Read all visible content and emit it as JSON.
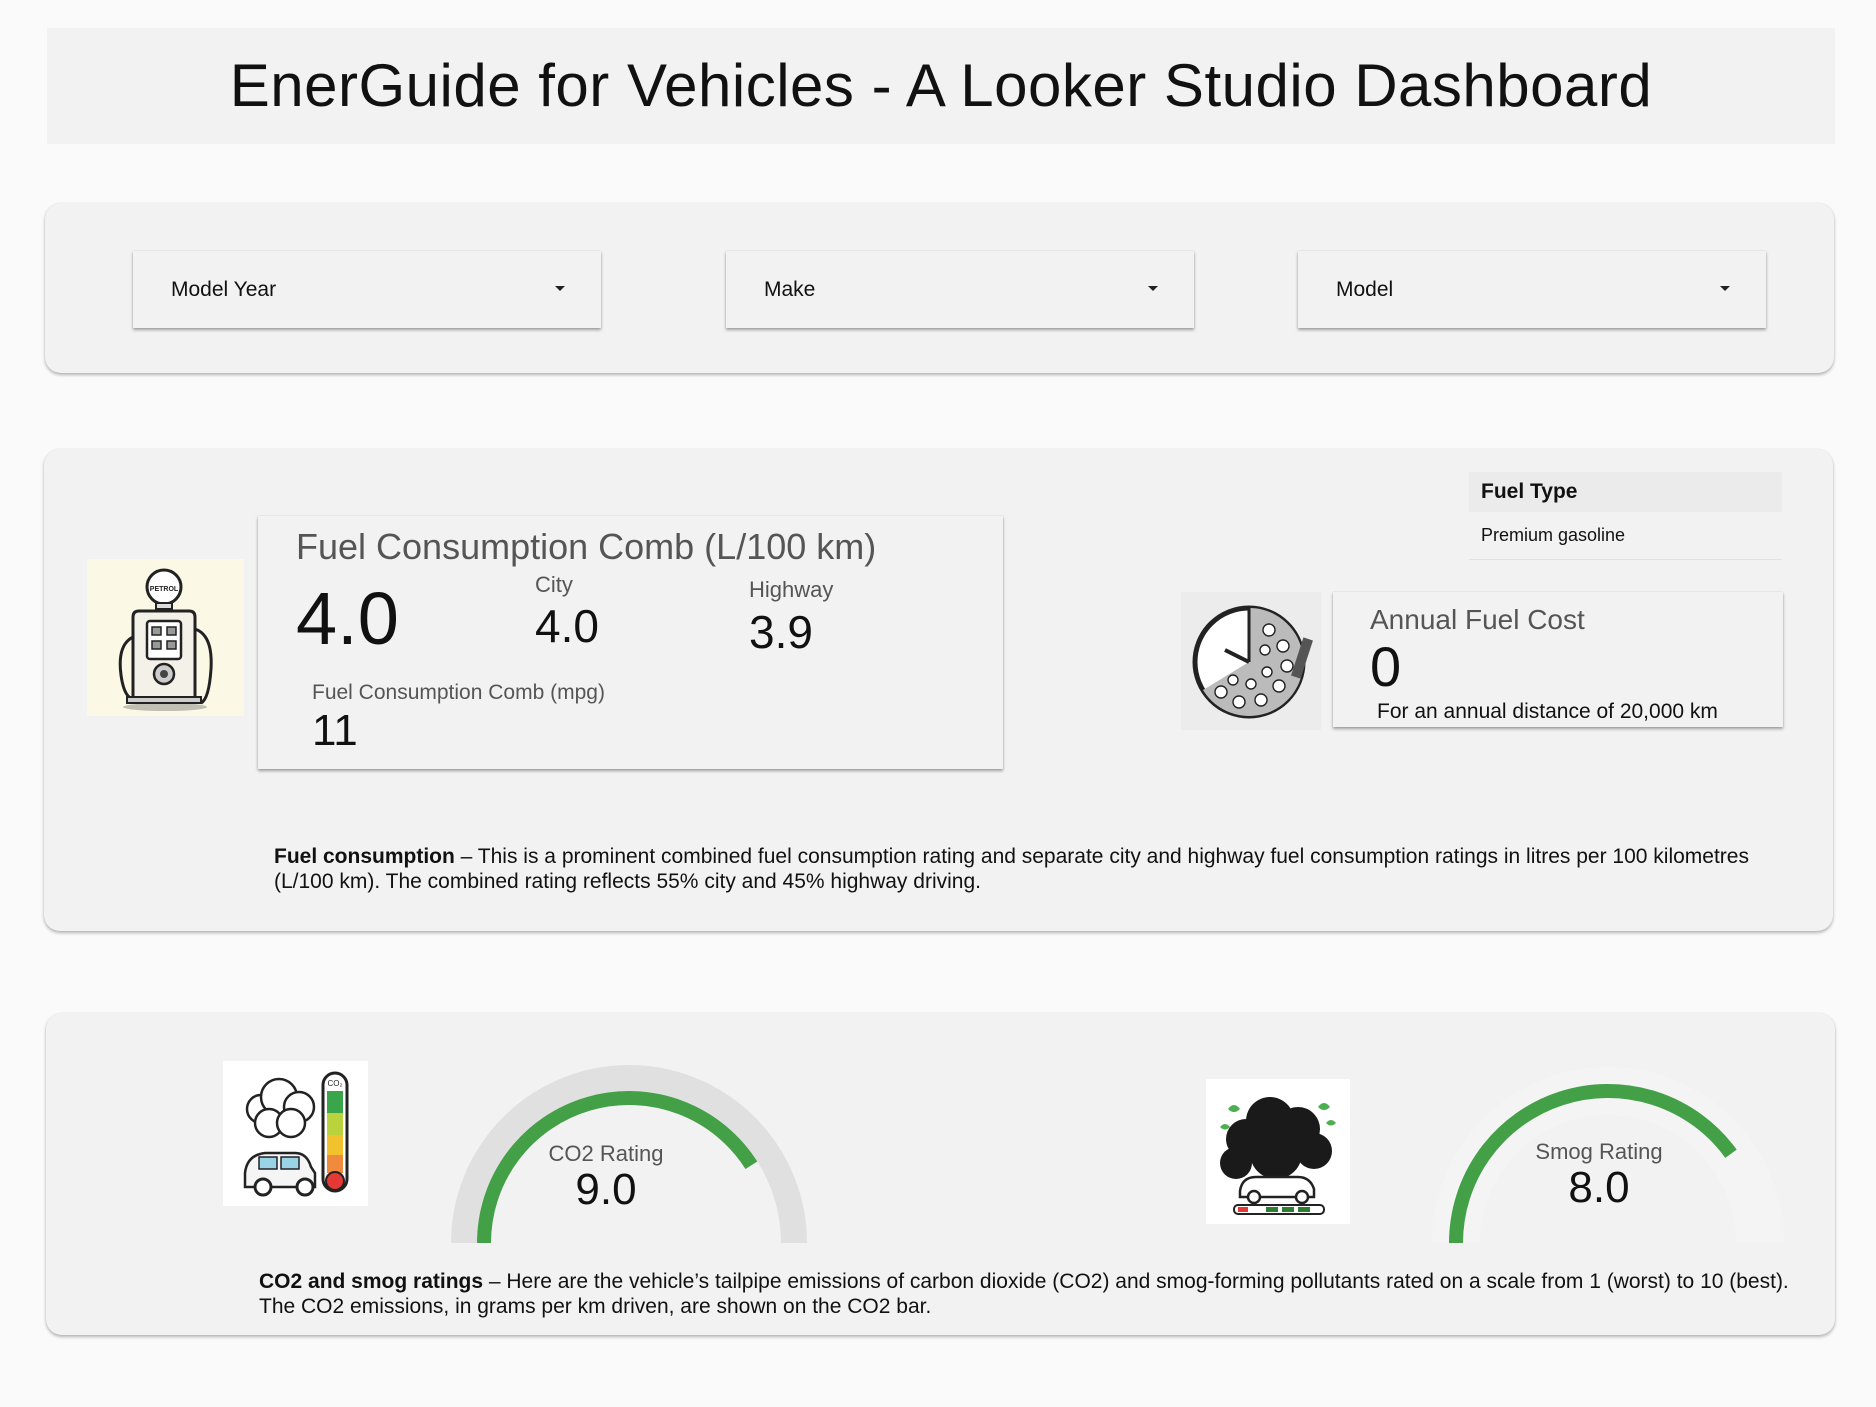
{
  "header": {
    "title": "EnerGuide for Vehicles - A Looker Studio Dashboard"
  },
  "filters": {
    "model_year": "Model Year",
    "make": "Make",
    "model": "Model"
  },
  "fuel_section": {
    "comb_title": "Fuel Consumption Comb (L/100 km)",
    "comb_value": "4.0",
    "city_label": "City",
    "city_value": "4.0",
    "highway_label": "Highway",
    "highway_value": "3.9",
    "mpg_label": "Fuel Consumption Comb (mpg)",
    "mpg_value": "11",
    "fuel_type_header": "Fuel Type",
    "fuel_type_value": "Premium gasoline",
    "annual_cost_title": "Annual Fuel Cost",
    "annual_cost_value": "0",
    "annual_cost_note": "For an annual distance of 20,000 km",
    "desc_bold": "Fuel consumption",
    "desc_text": " – This is a prominent combined fuel consumption rating and separate city and highway fuel consumption ratings in litres per 100 kilometres (L/100 km). The combined rating reflects 55% city and 45% highway driving.",
    "pump_icon_text": "PETROL"
  },
  "emissions_section": {
    "co2_label": "CO2 Rating",
    "co2_value": "9.0",
    "co2_fraction": 0.82,
    "smog_label": "Smog Rating",
    "smog_value": "8.0",
    "smog_fraction": 0.8,
    "co2_icon_text": "CO₂",
    "desc_bold": "CO2 and smog ratings",
    "desc_text": " – Here are the vehicle’s tailpipe emissions of carbon dioxide (CO2) and smog-forming pollutants rated on a scale from 1 (worst) to 10 (best). The CO2 emissions, in grams per km driven, are shown on the CO2 bar."
  },
  "colors": {
    "gauge_fill": "#43a047",
    "gauge_track": "#e0e0e0",
    "panel_bg": "#f2f2f2"
  }
}
